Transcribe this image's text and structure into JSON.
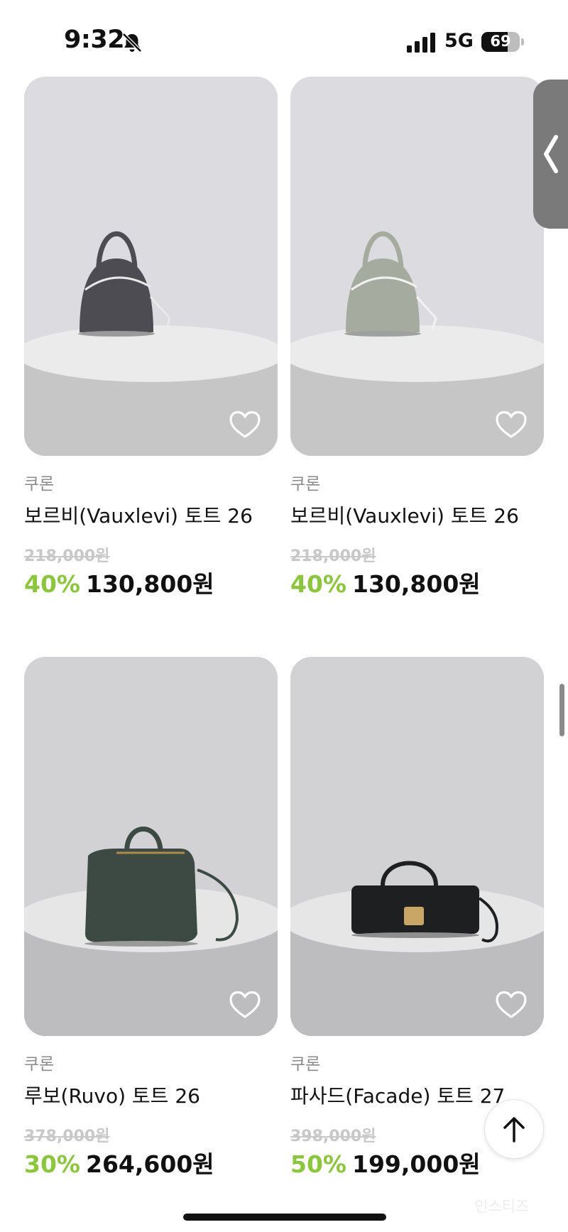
{
  "status_bar": {
    "time": "9:32",
    "network": "5G",
    "battery": "69",
    "battery_level": 0.69,
    "icons": [
      "bell-slash-icon",
      "signal-icon",
      "battery-icon"
    ]
  },
  "products": [
    {
      "brand": "쿠론",
      "name": "보르비(Vauxlevi) 토트 26",
      "original_price": "218,000원",
      "discount": "40%",
      "price": "130,800원",
      "bag_color": "#4d4c52"
    },
    {
      "brand": "쿠론",
      "name": "보르비(Vauxlevi) 토트 26",
      "original_price": "218,000원",
      "discount": "40%",
      "price": "130,800원",
      "bag_color": "#a6ab9f"
    },
    {
      "brand": "쿠론",
      "name": "루보(Ruvo) 토트 26",
      "original_price": "378,000원",
      "discount": "30%",
      "price": "264,600원",
      "bag_color": "#3d4a44"
    },
    {
      "brand": "쿠론",
      "name": "파사드(Facade) 토트 27",
      "original_price": "398,000원",
      "discount": "50%",
      "price": "199,000원",
      "bag_color": "#1e1f21"
    }
  ],
  "controls": {
    "side_tab_icon": "chevron-left-icon",
    "scroll_top_icon": "arrow-up-icon",
    "wishlist_icon": "heart-icon"
  },
  "watermark": "인스티즈",
  "colors": {
    "discount": "#8cc63f",
    "original_price": "#c8c8c8",
    "brand": "#8a8a8a"
  }
}
